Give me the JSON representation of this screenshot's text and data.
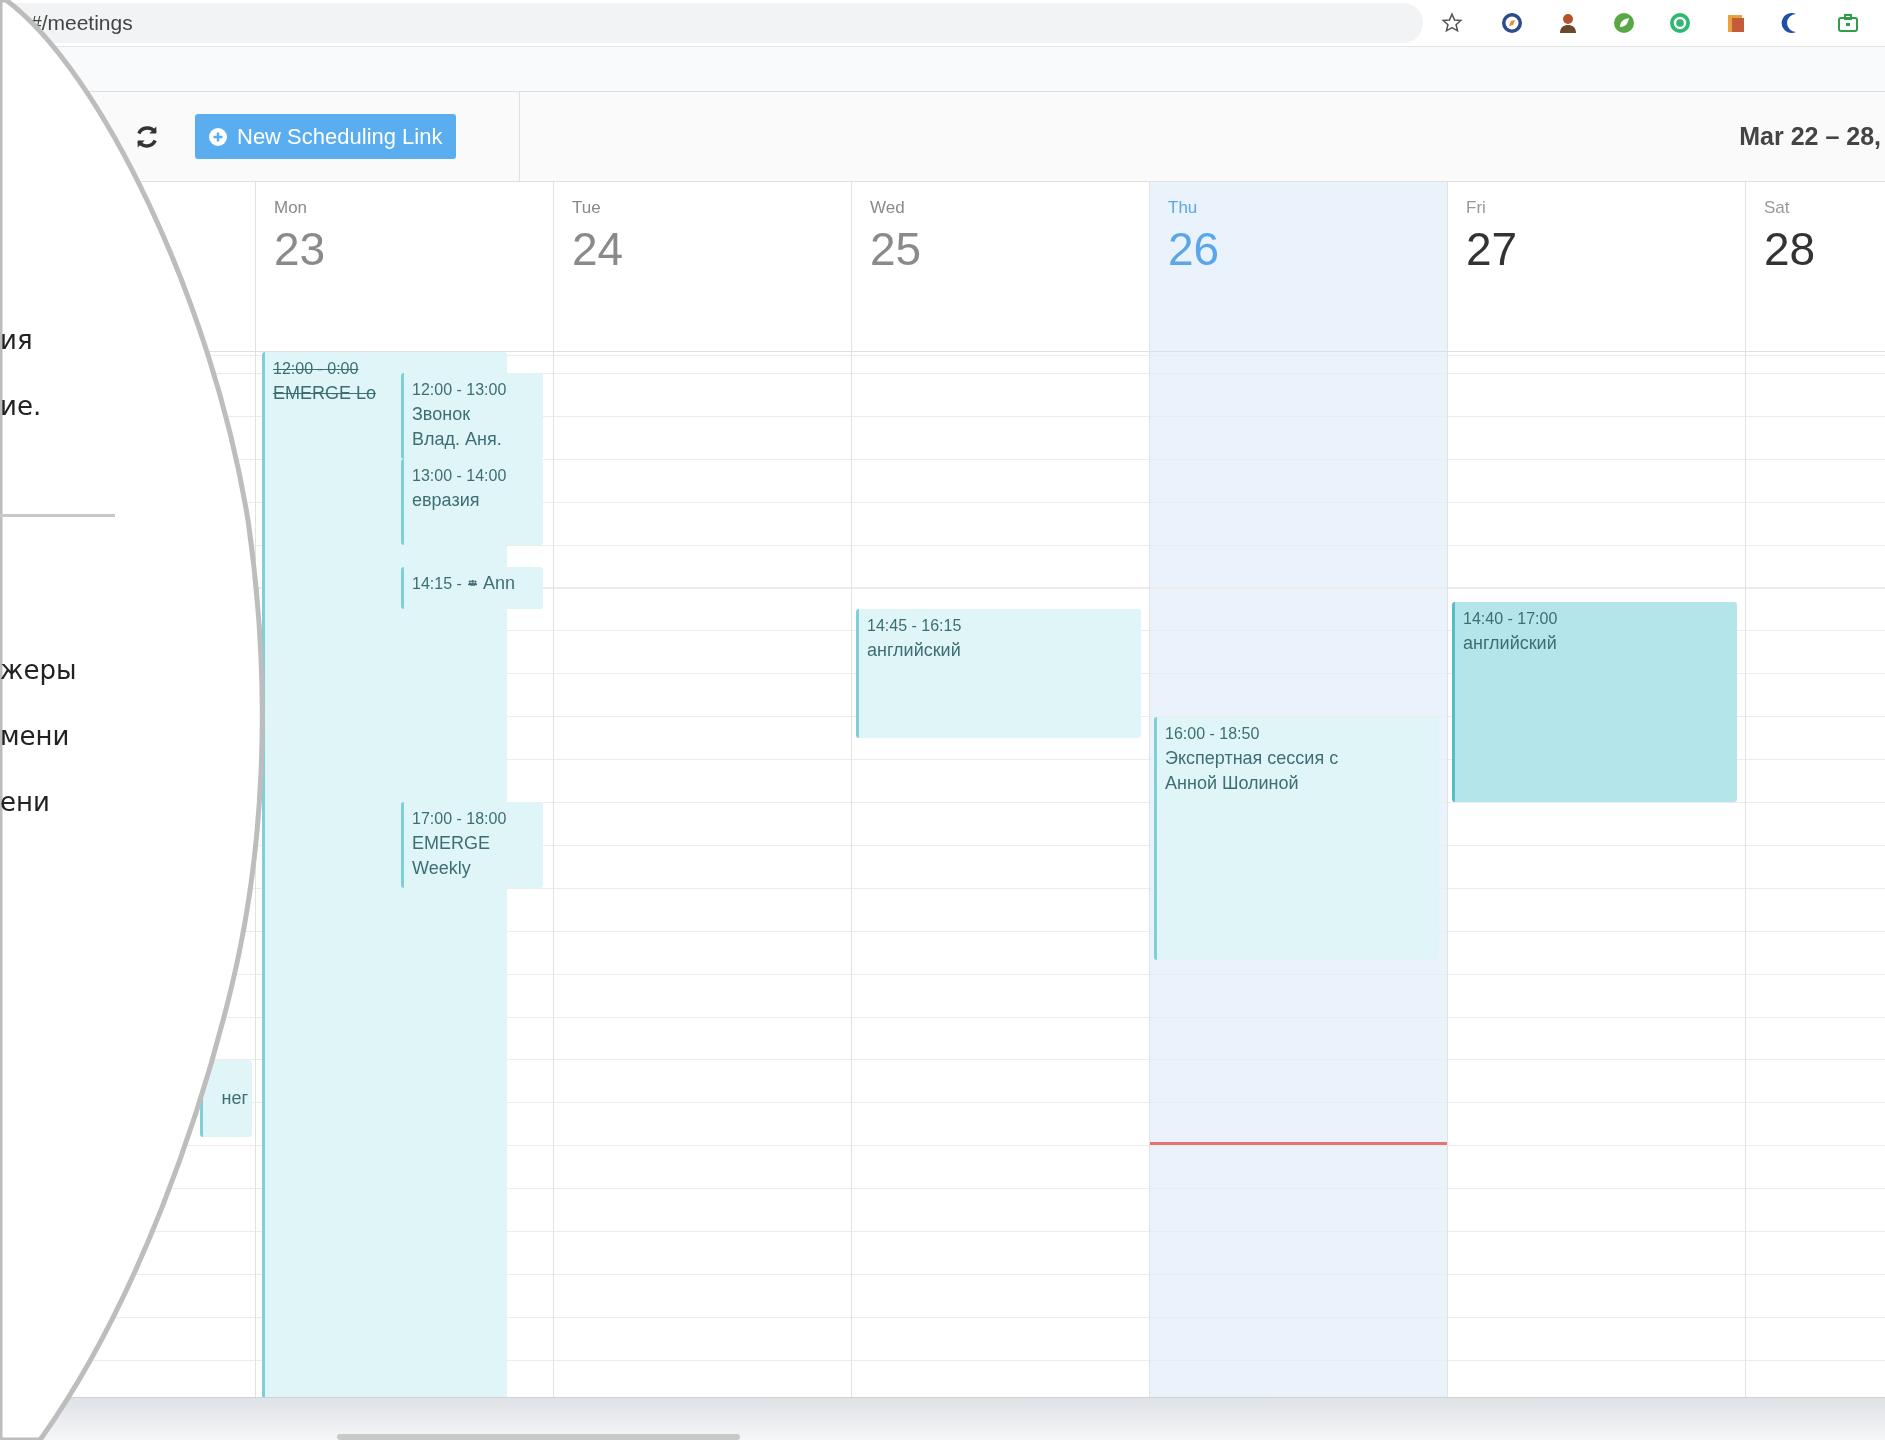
{
  "browser": {
    "url": "#/meetings"
  },
  "toolbar": {
    "new_link_button": "New Scheduling Link",
    "date_range": "Mar 22 – 28,"
  },
  "sunday_column": {
    "events": [
      {
        "title": "нег",
        "cancelled": false,
        "selected": false,
        "kind": "plain"
      }
    ]
  },
  "days": [
    {
      "name": "Mon",
      "number": "23",
      "today": false,
      "past": true,
      "events": [
        {
          "time": "12:00 - 0:00",
          "title": "EMERGE Lo",
          "cancelled": true,
          "selected": false,
          "kind": "plain"
        },
        {
          "time": "12:00 - 13:00",
          "title": "Звонок Влад. Аня.",
          "cancelled": false,
          "selected": false,
          "kind": "plain"
        },
        {
          "time": "13:00 - 14:00",
          "title": "евразия",
          "cancelled": false,
          "selected": false,
          "kind": "plain"
        },
        {
          "time": "14:15 -",
          "title": "Ann",
          "cancelled": false,
          "selected": false,
          "kind": "group"
        },
        {
          "time": "17:00 - 18:00",
          "title": "EMERGE Weekly",
          "cancelled": false,
          "selected": false,
          "kind": "plain"
        }
      ]
    },
    {
      "name": "Tue",
      "number": "24",
      "today": false,
      "past": true
    },
    {
      "name": "Wed",
      "number": "25",
      "today": false,
      "past": true,
      "events": [
        {
          "time": "14:45 - 16:15",
          "title": "английский",
          "cancelled": false,
          "selected": false,
          "kind": "plain"
        }
      ]
    },
    {
      "name": "Thu",
      "number": "26",
      "today": true,
      "past": false,
      "events": [
        {
          "time": "16:00 - 18:50",
          "title": "Экспертная сессия с Анной Шолиной",
          "cancelled": false,
          "selected": false,
          "kind": "plain"
        }
      ]
    },
    {
      "name": "Fri",
      "number": "27",
      "today": false,
      "past": false,
      "events": [
        {
          "time": "14:40 - 17:00",
          "title": "английский",
          "cancelled": false,
          "selected": true,
          "kind": "plain"
        }
      ]
    },
    {
      "name": "Sat",
      "number": "28",
      "today": false,
      "past": false
    }
  ],
  "overlay": {
    "items": [
      {
        "kind": "text",
        "text": "ия"
      },
      {
        "kind": "text",
        "text": "ие."
      },
      {
        "kind": "rule"
      },
      {
        "kind": "text",
        "text": "жеры"
      },
      {
        "kind": "text",
        "text": "мени"
      },
      {
        "kind": "text",
        "text": "ени"
      }
    ]
  }
}
